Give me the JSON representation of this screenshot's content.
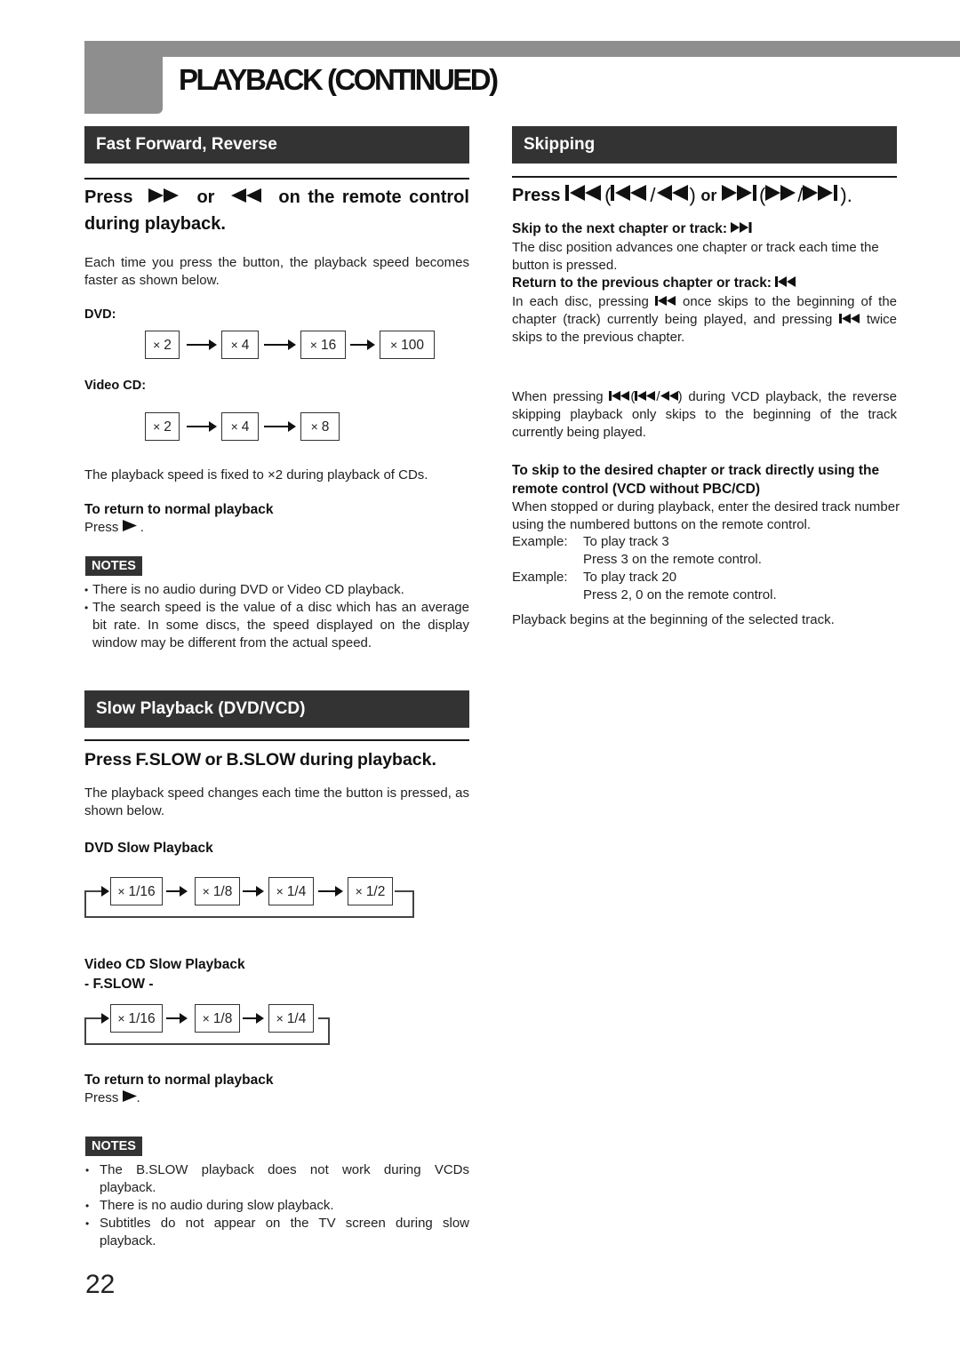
{
  "page": {
    "title": "PLAYBACK (CONTINUED)",
    "page_number": "22"
  },
  "fast_forward": {
    "section_title": "Fast Forward, Reverse",
    "step_prefix": "Press",
    "step_or": "or",
    "step_suffix": "on the remote control",
    "step_line2": "during playback.",
    "intro": "Each time you press the button, the playback speed becomes faster as shown below.",
    "dvd_label": "DVD:",
    "dvd_speeds": [
      "2",
      "4",
      "16",
      "100"
    ],
    "vcd_label": "Video CD:",
    "vcd_speeds": [
      "2",
      "4",
      "8"
    ],
    "speed_prefix": "×",
    "cd_note": "The playback speed is fixed to ×2 during playback of CDs.",
    "return_heading": "To return to normal playback",
    "return_text": "Press",
    "return_end": ".",
    "notes_label": "NOTES",
    "notes": [
      "There is no audio during DVD or Video CD  playback.",
      "The search speed is the value of a disc which has an average bit rate.  In some discs, the speed displayed on the display window may be different from the actual speed."
    ]
  },
  "slow": {
    "section_title": "Slow Playback (DVD/VCD)",
    "step": "Press F.SLOW or B.SLOW during playback.",
    "intro": "The playback speed changes each time the button is pressed, as shown below.",
    "dvd_heading": "DVD Slow Playback",
    "dvd_speeds": [
      "1/16",
      "1/8",
      "1/4",
      "1/2"
    ],
    "vcd_heading": "Video CD Slow Playback",
    "vcd_subheading": "- F.SLOW -",
    "vcd_speeds": [
      "1/16",
      "1/8",
      "1/4"
    ],
    "speed_prefix": "×",
    "return_heading": "To return to normal playback",
    "return_text": "Press",
    "return_end": ".",
    "notes_label": "NOTES",
    "notes": [
      "The B.SLOW playback does not work during VCDs playback.",
      "There is no audio during slow playback.",
      "Subtitles do not appear on the TV screen during slow playback."
    ]
  },
  "skipping": {
    "section_title": "Skipping",
    "step_prefix": "Press",
    "step_or": "or",
    "next_heading": "Skip to the next chapter or track:",
    "next_text": "The disc position advances one chapter or track each time the button is pressed.",
    "prev_heading": "Return to the previous chapter or track:",
    "prev_text_1": "In each disc, pressing",
    "prev_text_2": "once skips to the beginning of the chapter (track) currently being played, and pressing",
    "prev_text_3": "twice skips to the previous chapter.",
    "vcd_text_1": "When pressing",
    "vcd_text_2": "during VCD playback, the reverse skipping playback only skips to the beginning of the track currently being played.",
    "direct_heading": "To skip to the desired chapter or track directly using the remote control (VCD without PBC/CD)",
    "direct_text": "When stopped or during playback, enter the desired track number using the numbered buttons on the remote control.",
    "examples": [
      {
        "label": "Example:",
        "line1": "To play track 3",
        "line2": "Press 3 on the remote control."
      },
      {
        "label": "Example:",
        "line1": "To play track 20",
        "line2": "Press 2, 0 on the remote control."
      }
    ],
    "closing": "Playback begins at the beginning of the selected track."
  }
}
